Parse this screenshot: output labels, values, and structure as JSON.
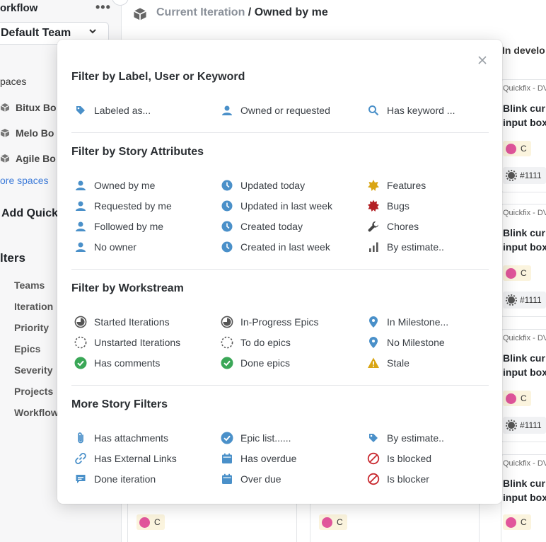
{
  "sidebar": {
    "workflow_label": "orkflow",
    "menu_dots": "•••",
    "team": "Default Team",
    "spaces_label": "paces",
    "spaces": [
      "Bitux Bo",
      "Melo Bo",
      "Agile Bo"
    ],
    "more_spaces": "ore spaces",
    "add_quick": "Add Quick",
    "filters_label": "lters",
    "filter_items": [
      "Teams",
      "Iteration",
      "Priority",
      "Epics",
      "Severity",
      "Projects",
      "Workflow"
    ]
  },
  "breadcrumb": {
    "parent": "Current Iteration",
    "separator": "/",
    "current": "Owned by me"
  },
  "board": {
    "column_title": "In develo",
    "cards": [
      {
        "meta": "Quickfix - DV",
        "title_line1": "Blink cur",
        "title_line2": "input box",
        "chip": "C",
        "badge": "#1111"
      },
      {
        "meta": "Quickfix - DV",
        "title_line1": "Blink cur",
        "title_line2": "input box",
        "chip": "C",
        "badge": "#1111"
      },
      {
        "meta": "Quickfix - DV",
        "title_line1": "Blink cur",
        "title_line2": "input box",
        "chip": "C",
        "badge": "#1111"
      },
      {
        "meta": "Quickfix - DV",
        "title_line1": "Blink cur",
        "title_line2": "input box",
        "chip": "C"
      }
    ],
    "bottom_chips": [
      "C",
      "C"
    ]
  },
  "modal": {
    "close_label": "×",
    "sections": [
      {
        "title": "Filter by Label, User or Keyword",
        "rows": [
          [
            {
              "label": "Labeled as...",
              "icon": "tag-icon"
            },
            {
              "label": "Owned or requested",
              "icon": "user-icon"
            },
            {
              "label": "Has keyword ...",
              "icon": "search-icon"
            }
          ]
        ]
      },
      {
        "title": "Filter by Story Attributes",
        "rows": [
          [
            {
              "label": "Owned by me",
              "icon": "user-icon"
            },
            {
              "label": "Updated today",
              "icon": "clock-icon"
            },
            {
              "label": "Features",
              "icon": "feature-star-icon"
            }
          ],
          [
            {
              "label": "Requested by me",
              "icon": "user-icon"
            },
            {
              "label": "Updated in last week",
              "icon": "clock-icon"
            },
            {
              "label": "Bugs",
              "icon": "bug-icon"
            }
          ],
          [
            {
              "label": "Followed by me",
              "icon": "user-icon"
            },
            {
              "label": "Created today",
              "icon": "clock-icon"
            },
            {
              "label": "Chores",
              "icon": "wrench-icon"
            }
          ],
          [
            {
              "label": "No owner",
              "icon": "user-icon"
            },
            {
              "label": "Created in last week",
              "icon": "clock-icon"
            },
            {
              "label": "By estimate..",
              "icon": "bar-chart-icon"
            }
          ]
        ]
      },
      {
        "title": "Filter by Workstream",
        "rows": [
          [
            {
              "label": "Started Iterations",
              "icon": "progress-circle-icon"
            },
            {
              "label": "In-Progress Epics",
              "icon": "progress-circle-icon"
            },
            {
              "label": "In Milestone...",
              "icon": "map-pin-icon"
            }
          ],
          [
            {
              "label": "Unstarted Iterations",
              "icon": "dashed-circle-icon"
            },
            {
              "label": "To do epics",
              "icon": "dashed-circle-icon"
            },
            {
              "label": "No Milestone",
              "icon": "map-pin-icon"
            }
          ],
          [
            {
              "label": "Has comments",
              "icon": "check-circle-icon"
            },
            {
              "label": "Done epics",
              "icon": "check-circle-icon"
            },
            {
              "label": "Stale",
              "icon": "warning-icon"
            }
          ]
        ]
      },
      {
        "title": "More Story Filters",
        "rows": [
          [
            {
              "label": "Has attachments",
              "icon": "paperclip-icon"
            },
            {
              "label": "Epic list......",
              "icon": "check-badge-icon"
            },
            {
              "label": "By estimate..",
              "icon": "tag-icon"
            }
          ],
          [
            {
              "label": "Has External Links",
              "icon": "link-icon"
            },
            {
              "label": "Has overdue",
              "icon": "calendar-icon"
            },
            {
              "label": "Is blocked",
              "icon": "blocked-icon"
            }
          ],
          [
            {
              "label": "Done iteration",
              "icon": "comment-icon"
            },
            {
              "label": "Over due",
              "icon": "calendar-icon"
            },
            {
              "label": "Is blocker",
              "icon": "blocked-icon"
            }
          ]
        ]
      }
    ]
  },
  "colors": {
    "accent_blue": "#4a90c9",
    "green": "#3aa757",
    "yellow": "#d9a514",
    "bug_red": "#b32024",
    "blocked_red": "#c8282e",
    "chip_pink": "#e1569b"
  }
}
